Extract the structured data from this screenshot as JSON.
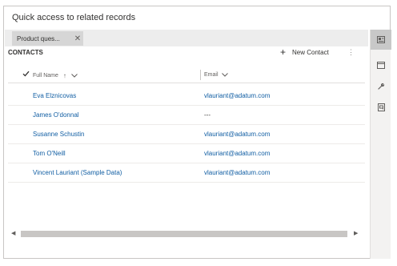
{
  "panel": {
    "title": "Quick access to related records"
  },
  "tab": {
    "label": "Product ques...",
    "close_glyph": "✕"
  },
  "grid": {
    "title": "CONTACTS",
    "new_label": "New Contact",
    "more_glyph": "⋮",
    "columns": {
      "full_name": "Full Name",
      "email": "Email",
      "sort_glyph": "↑"
    },
    "rows": [
      {
        "name": "Eva Elznicovas",
        "email": "vlauriant@adatum.com"
      },
      {
        "name": "James O'donnal",
        "email": "---"
      },
      {
        "name": "Susanne Schustin",
        "email": "vlauriant@adatum.com"
      },
      {
        "name": "Tom O'Neill",
        "email": "vlauriant@adatum.com"
      },
      {
        "name": "Vincent Lauriant (Sample Data)",
        "email": "vlauriant@adatum.com"
      }
    ]
  },
  "scroll": {
    "left_glyph": "◀",
    "right_glyph": "▶",
    "position": 0,
    "visible_fraction": 1
  },
  "rail": {
    "items": [
      "contact-card-icon",
      "window-icon",
      "wrench-icon",
      "document-icon"
    ],
    "active": "contact-card-icon"
  }
}
